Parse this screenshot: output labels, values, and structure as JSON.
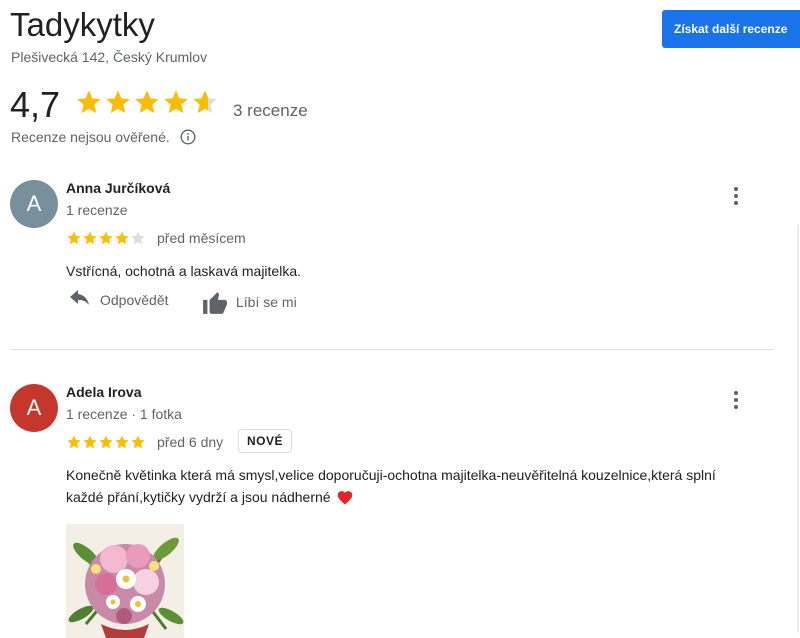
{
  "business": {
    "name": "Tadykytky",
    "address": "Plešivecká 142, Český Krumlov"
  },
  "header": {
    "more_reviews_label": "Získat další recenze"
  },
  "summary": {
    "rating": "4,7",
    "rating_value": 4.7,
    "review_count": "3 recenze",
    "verified_note": "Recenze nejsou ověřené.",
    "star_color": "#fbbc04"
  },
  "reviews": [
    {
      "avatar_letter": "A",
      "avatar_color": "#78909c",
      "name": "Anna Jurčíková",
      "meta": "1 recenze",
      "stars": 4,
      "date": "před měsícem",
      "text": "Vstřícná, ochotná a laskavá majitelka.",
      "reply_label": "Odpovědět",
      "like_label": "Líbí se mi"
    },
    {
      "avatar_letter": "A",
      "avatar_color": "#c5372c",
      "name": "Adela Irova",
      "meta": "1 recenze · 1 fotka",
      "stars": 5,
      "date": "před 6 dny",
      "badge": "NOVÉ",
      "text": "Konečně květinka která má smysl,velice doporučuji-ochotna majitelka-neuvěřitelná kouzelnice,která splní každé přání,kytičky vydrží a jsou nádherné"
    }
  ]
}
